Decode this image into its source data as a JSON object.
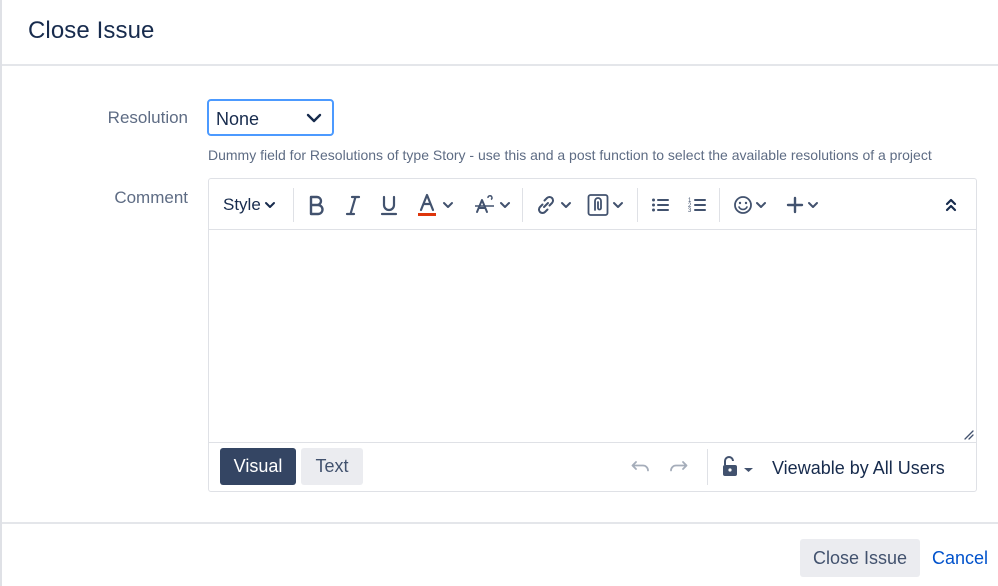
{
  "dialog": {
    "title": "Close Issue"
  },
  "resolution": {
    "label": "Resolution",
    "value": "None",
    "help": "Dummy field for Resolutions of type Story - use this and a post function to select the available resolutions of a project"
  },
  "comment": {
    "label": "Comment",
    "toolbar": {
      "style_label": "Style",
      "icons": [
        "bold-icon",
        "italic-icon",
        "underline-icon",
        "text-color-icon",
        "more-formatting-icon",
        "link-icon",
        "attachment-icon",
        "bullet-list-icon",
        "numbered-list-icon",
        "emoji-icon",
        "insert-more-icon",
        "collapse-toolbar-icon"
      ],
      "text_color": "#de350b"
    },
    "modes": {
      "visual": "Visual",
      "text": "Text"
    },
    "visibility": "Viewable by All Users"
  },
  "footer": {
    "submit": "Close Issue",
    "cancel": "Cancel"
  }
}
